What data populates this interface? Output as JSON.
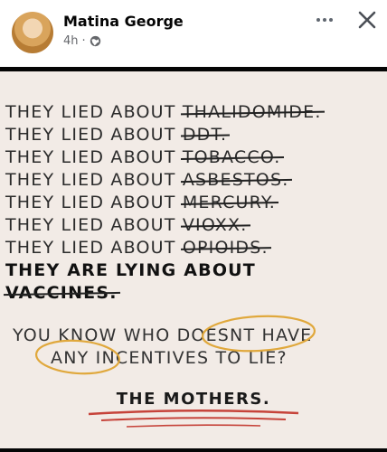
{
  "post": {
    "author": "Matina George",
    "time": "4h",
    "audience_icon": "globe-icon"
  },
  "image_text": {
    "lines": [
      {
        "prefix": "THEY LIED ABOUT ",
        "struck": "THALIDOMIDE."
      },
      {
        "prefix": "THEY LIED ABOUT ",
        "struck": "DDT."
      },
      {
        "prefix": "THEY LIED ABOUT ",
        "struck": "TOBACCO."
      },
      {
        "prefix": "THEY LIED ABOUT ",
        "struck": "ASBESTOS."
      },
      {
        "prefix": "THEY LIED ABOUT ",
        "struck": "MERCURY."
      },
      {
        "prefix": "THEY LIED ABOUT ",
        "struck": "VIOXX."
      },
      {
        "prefix": "THEY LIED ABOUT ",
        "struck": "OPIOIDS."
      }
    ],
    "bold_line_1": "THEY ARE LYING ABOUT",
    "bold_line_2": "VACCINES.",
    "question_1": "YOU KNOW WHO DOESNT HAVE",
    "question_2": "ANY INCENTIVES TO LIE?",
    "answer": "THE MOTHERS."
  },
  "colors": {
    "circle": "#e0a83c",
    "underline": "#c6433a",
    "background": "#f2ebe6"
  }
}
